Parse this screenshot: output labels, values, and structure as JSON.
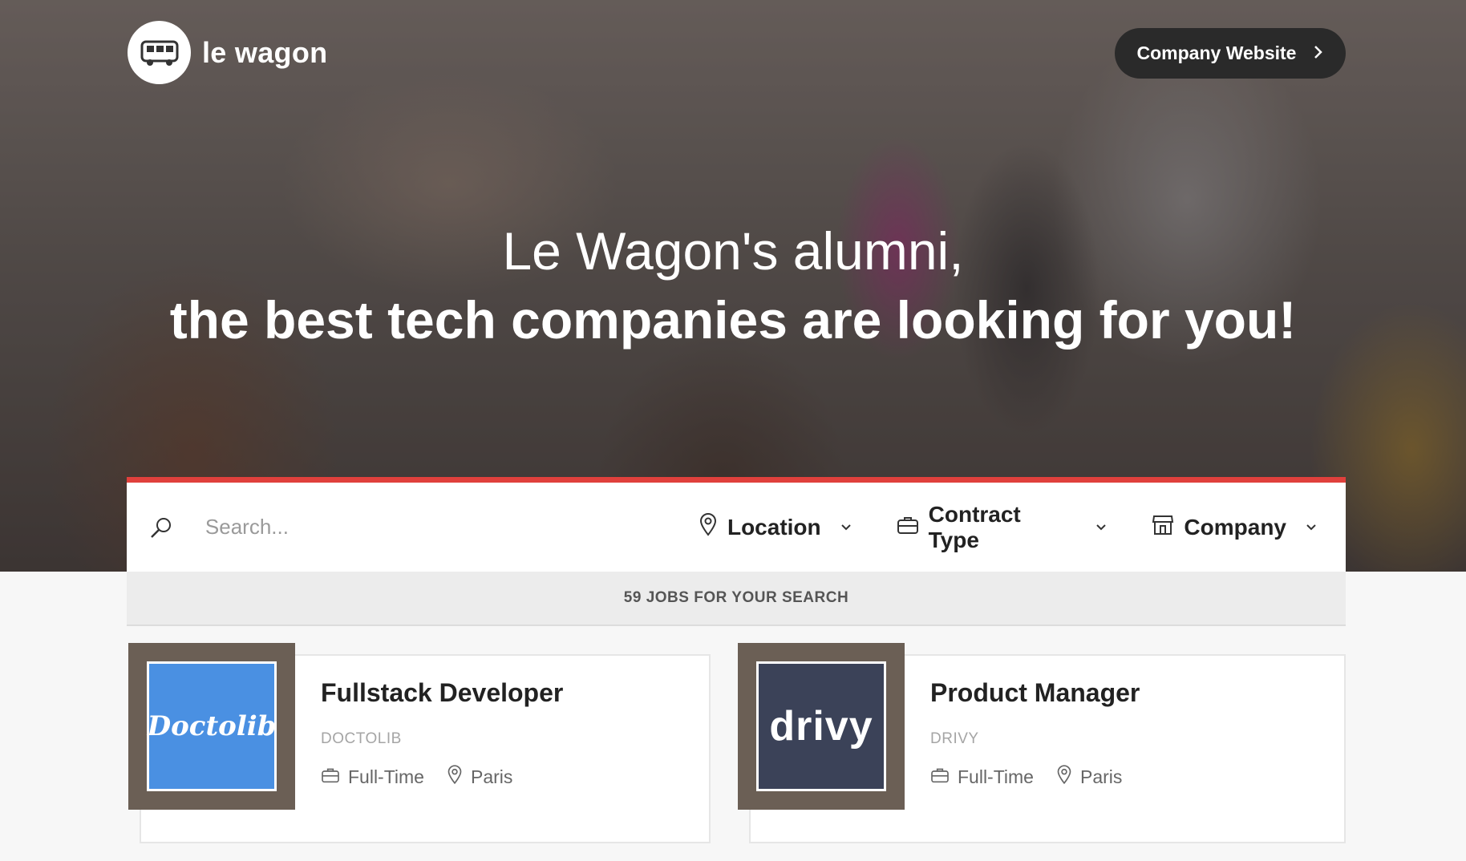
{
  "header": {
    "brand_name": "le wagon",
    "company_button_label": "Company Website"
  },
  "hero": {
    "line1": "Le Wagon's alumni,",
    "line2": "the best tech companies are looking for you!"
  },
  "search": {
    "placeholder": "Search...",
    "filters": [
      {
        "label": "Location",
        "icon": "map-pin-icon"
      },
      {
        "label": "Contract Type",
        "icon": "briefcase-icon"
      },
      {
        "label": "Company",
        "icon": "store-icon"
      }
    ],
    "accent_color": "#e0403c"
  },
  "results": {
    "summary": "59 JOBS FOR YOUR SEARCH"
  },
  "jobs": [
    {
      "title": "Fullstack Developer",
      "company": "DOCTOLIB",
      "logo_text": "Doctolib",
      "logo_color": "#4a90e2",
      "contract": "Full-Time",
      "location": "Paris"
    },
    {
      "title": "Product Manager",
      "company": "DRIVY",
      "logo_text": "drivy",
      "logo_color": "#3b4258",
      "contract": "Full-Time",
      "location": "Paris"
    }
  ]
}
